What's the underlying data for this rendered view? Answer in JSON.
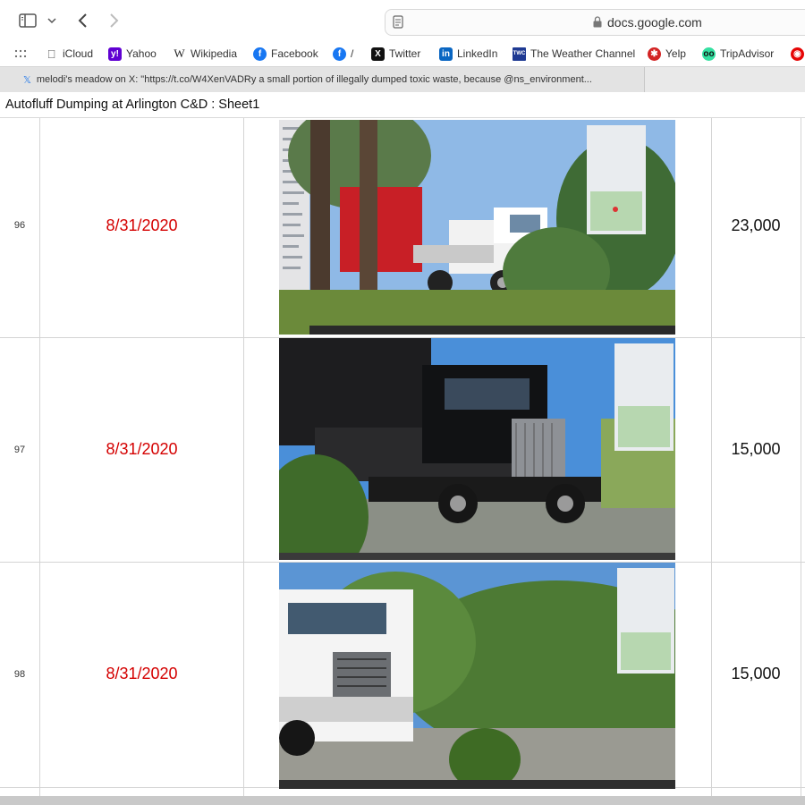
{
  "browser": {
    "url": "docs.google.com",
    "favorites": [
      {
        "label": "iCloud",
        "icon": "apple-icon"
      },
      {
        "label": "Yahoo",
        "icon": "yahoo-icon"
      },
      {
        "label": "Wikipedia",
        "icon": "wikipedia-icon"
      },
      {
        "label": "Facebook",
        "icon": "facebook-icon"
      },
      {
        "label": "/",
        "icon": "facebook-icon"
      },
      {
        "label": "Twitter",
        "icon": "x-icon"
      },
      {
        "label": "LinkedIn",
        "icon": "linkedin-icon"
      },
      {
        "label": "The Weather Channel",
        "icon": "weather-channel-icon"
      },
      {
        "label": "Yelp",
        "icon": "yelp-icon"
      },
      {
        "label": "TripAdvisor",
        "icon": "tripadvisor-icon"
      }
    ],
    "tab": {
      "title": "melodi's meadow on X: \"https://t.co/W4XenVADRy a small portion of illegally dumped toxic waste, because @ns_environment..."
    }
  },
  "doc": {
    "title": "Autofluff Dumping at Arlington C&D : Sheet1"
  },
  "sheet": {
    "rows": [
      {
        "num": "96",
        "date": "8/31/2020",
        "amount": "23,000",
        "photo": "red and white truck behind trees"
      },
      {
        "num": "97",
        "date": "8/31/2020",
        "amount": "15,000",
        "photo": "black dump truck"
      },
      {
        "num": "98",
        "date": "8/31/2020",
        "amount": "15,000",
        "photo": "white truck on gravel road"
      }
    ]
  },
  "colors": {
    "date_text": "#d40000",
    "accent": "#2b7de9"
  }
}
